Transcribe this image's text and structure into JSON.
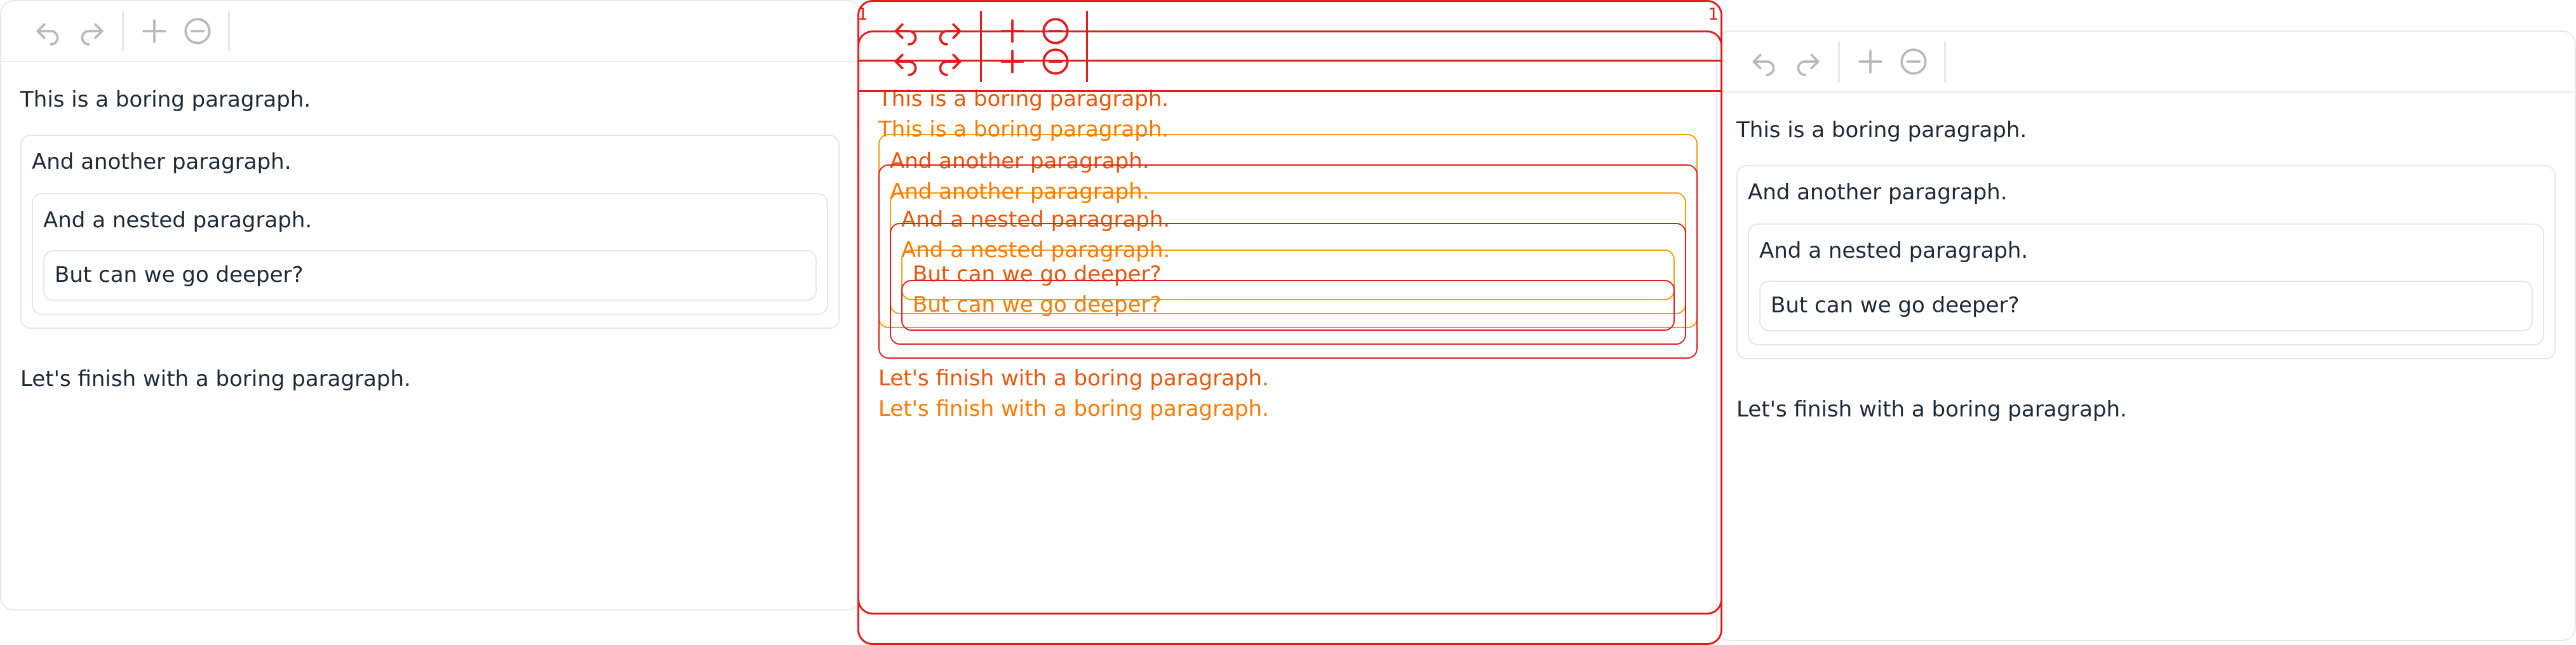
{
  "toolbar": {
    "undo_icon": "undo-icon",
    "redo_icon": "redo-icon",
    "add_icon": "plus-icon",
    "remove_icon": "minus-circle-icon"
  },
  "document": {
    "p1": "This is a boring paragraph.",
    "p2": "And another paragraph.",
    "p3": "And a nested paragraph.",
    "p4": "But can we go deeper?",
    "p5": "Let's finish with a boring paragraph."
  },
  "overlay": {
    "marker_left": "1",
    "marker_right": "1"
  },
  "colors": {
    "diff_red": "#e11d1d",
    "diff_orange": "#f59e0b",
    "text": "#1f2937",
    "border": "#e5e7eb"
  }
}
